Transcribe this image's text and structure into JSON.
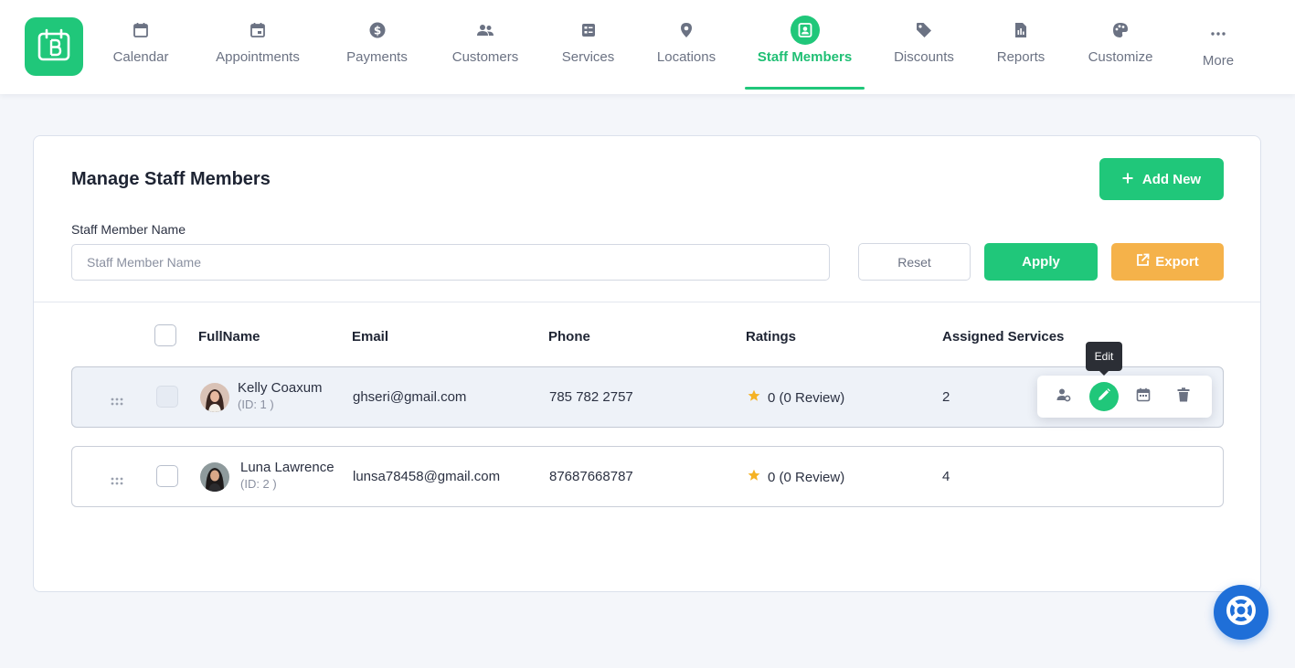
{
  "nav": {
    "items": [
      {
        "label": "Calendar",
        "icon": "calendar-icon"
      },
      {
        "label": "Appointments",
        "icon": "calendar-check-icon"
      },
      {
        "label": "Payments",
        "icon": "dollar-circle-icon"
      },
      {
        "label": "Customers",
        "icon": "users-icon"
      },
      {
        "label": "Services",
        "icon": "services-icon"
      },
      {
        "label": "Locations",
        "icon": "map-pin-icon"
      },
      {
        "label": "Staff Members",
        "icon": "badge-icon",
        "active": true
      },
      {
        "label": "Discounts",
        "icon": "tag-icon"
      },
      {
        "label": "Reports",
        "icon": "report-icon"
      },
      {
        "label": "Customize",
        "icon": "palette-icon"
      },
      {
        "label": "More",
        "icon": "dots-icon"
      }
    ]
  },
  "page": {
    "title": "Manage Staff Members",
    "add_new_label": "Add New",
    "filter": {
      "label": "Staff Member Name",
      "placeholder": "Staff Member Name",
      "value": ""
    },
    "reset_label": "Reset",
    "apply_label": "Apply",
    "export_label": "Export"
  },
  "table": {
    "columns": [
      "FullName",
      "Email",
      "Phone",
      "Ratings",
      "Assigned Services"
    ],
    "rows": [
      {
        "name": "Kelly Coaxum",
        "id_label": "(ID: 1 )",
        "email": "ghseri@gmail.com",
        "phone": "785 782 2757",
        "rating": "0 (0 Review)",
        "assigned_services": "2"
      },
      {
        "name": "Luna Lawrence",
        "id_label": "(ID: 2 )",
        "email": "lunsa78458@gmail.com",
        "phone": "87687668787",
        "rating": "0 (0 Review)",
        "assigned_services": "4"
      }
    ]
  },
  "actions": {
    "tooltip": "Edit",
    "icons": [
      "user-settings-icon",
      "edit-icon",
      "calendar-icon",
      "trash-icon"
    ]
  },
  "colors": {
    "brand": "#20c77a",
    "export": "#f5b24a",
    "help": "#1f6fd8",
    "star": "#f5b224"
  }
}
